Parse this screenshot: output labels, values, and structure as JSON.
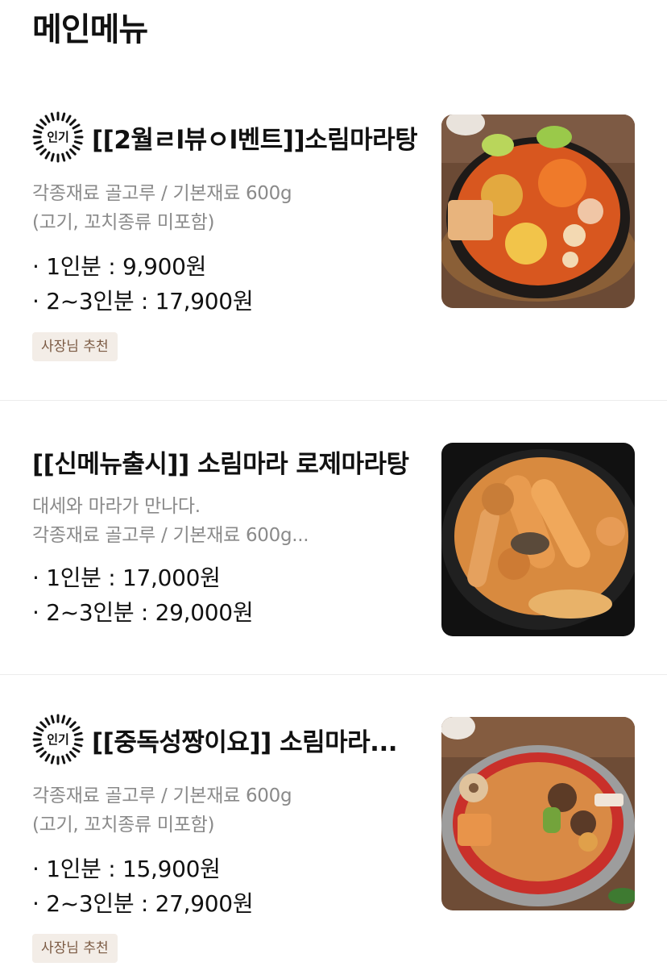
{
  "page": {
    "section_title": "메인메뉴"
  },
  "items": [
    {
      "popular": true,
      "popular_label": "인기",
      "name": "[[2월ㄹl뷰ㅇl벤트]]소림마라탕",
      "desc1": "각종재료 골고루 / 기본재료 600g",
      "desc2": "(고기, 꼬치종류 미포함)",
      "price1": "· 1인분 : 9,900원",
      "price2": "· 2~3인분 : 17,900원",
      "tag": "사장님 추천",
      "image_icon": "spicy-malatang-bowl"
    },
    {
      "popular": false,
      "popular_label": "",
      "name": "[[신메뉴출시]] 소림마라 로제마라탕",
      "desc1": "대세와 마라가 만나다.",
      "desc2": "각종재료 골고루 / 기본재료 600g...",
      "price1": "· 1인분 : 17,000원",
      "price2": "· 2~3인분 : 29,000원",
      "tag": "",
      "image_icon": "rose-malatang-bowl"
    },
    {
      "popular": true,
      "popular_label": "인기",
      "name": "[[중독성짱이요]] 소림마라...",
      "desc1": "각종재료 골고루 / 기본재료 600g",
      "desc2": "(고기, 꼬치종류 미포함)",
      "price1": "· 1인분 : 15,900원",
      "price2": "· 2~3인분 : 27,900원",
      "tag": "사장님 추천",
      "image_icon": "malaxiangguo-pan"
    }
  ]
}
